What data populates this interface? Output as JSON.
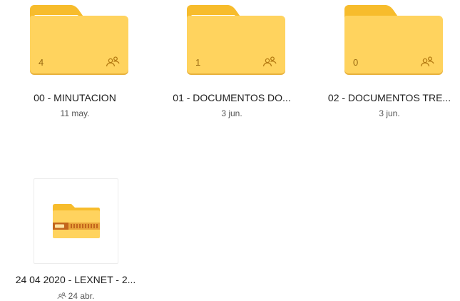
{
  "colors": {
    "folder_body": "#FFD35E",
    "folder_tab": "#F7BC2C",
    "folder_accent": "#B47A12",
    "zip_band": "#C3651C"
  },
  "items": [
    {
      "type": "folder",
      "name": "00 - MINUTACION",
      "date": "11 may.",
      "count": "4",
      "shared": true,
      "icon": "shared-folder-icon"
    },
    {
      "type": "folder",
      "name": "01 - DOCUMENTOS DO...",
      "date": "3 jun.",
      "count": "1",
      "shared": true,
      "icon": "shared-folder-icon"
    },
    {
      "type": "folder",
      "name": "02 - DOCUMENTOS TRE...",
      "date": "3 jun.",
      "count": "0",
      "shared": true,
      "icon": "shared-folder-icon"
    },
    {
      "type": "zip",
      "name": "24 04 2020 - LEXNET - 2...",
      "date": "24 abr.",
      "shared": true,
      "icon": "zip-folder-icon"
    }
  ]
}
